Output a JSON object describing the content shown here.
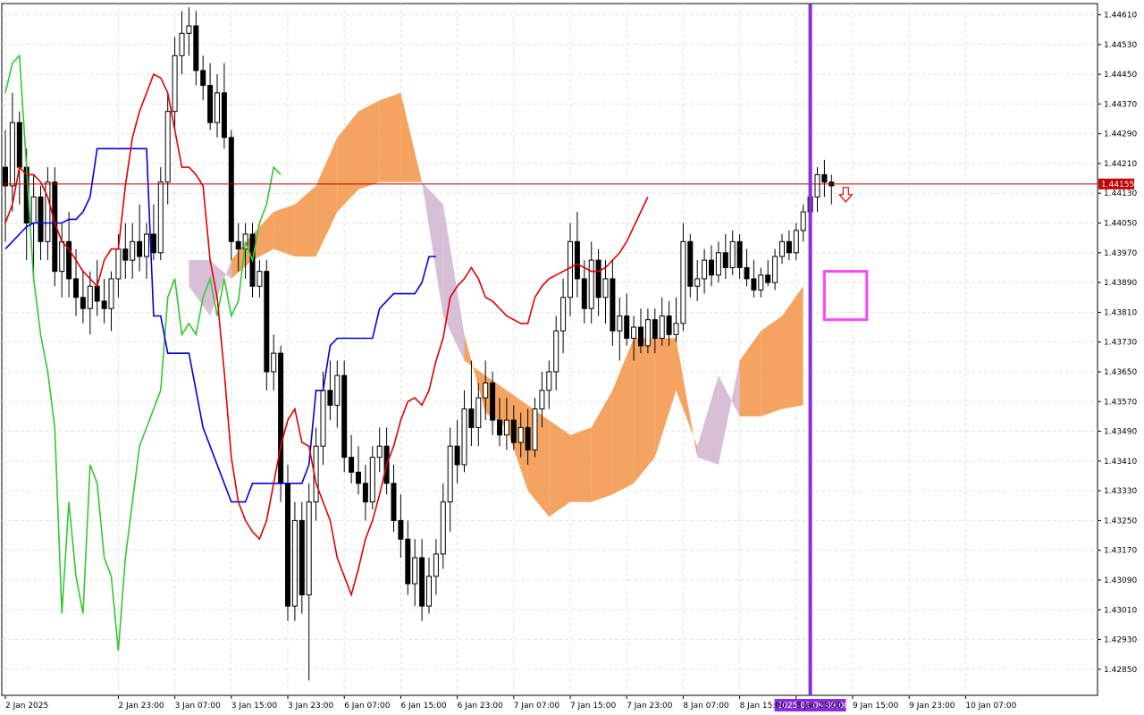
{
  "chart_data": {
    "type": "candlestick",
    "ylim": [
      1.4278,
      1.4464
    ],
    "y_ticks": [
      "1.44610",
      "1.44530",
      "1.44450",
      "1.44370",
      "1.44290",
      "1.44210",
      "1.44130",
      "1.44050",
      "1.43970",
      "1.43890",
      "1.43810",
      "1.43730",
      "1.43650",
      "1.43570",
      "1.43490",
      "1.43410",
      "1.43330",
      "1.43250",
      "1.43170",
      "1.43090",
      "1.43010",
      "1.42930",
      "1.42850"
    ],
    "x_ticks": [
      {
        "label": "2 Jan 2025",
        "index": 0
      },
      {
        "label": "2 Jan 23:00",
        "index": 16
      },
      {
        "label": "3 Jan 07:00",
        "index": 24
      },
      {
        "label": "3 Jan 15:00",
        "index": 32
      },
      {
        "label": "3 Jan 23:00",
        "index": 40
      },
      {
        "label": "6 Jan 07:00",
        "index": 48
      },
      {
        "label": "6 Jan 15:00",
        "index": 56
      },
      {
        "label": "6 Jan 23:00",
        "index": 64
      },
      {
        "label": "7 Jan 07:00",
        "index": 72
      },
      {
        "label": "7 Jan 15:00",
        "index": 80
      },
      {
        "label": "7 Jan 23:00",
        "index": 88
      },
      {
        "label": "8 Jan 07:00",
        "index": 96
      },
      {
        "label": "8 Jan 15:00",
        "index": 104
      },
      {
        "label": "8 Jan 23:00",
        "index": 112
      },
      {
        "label": "9 Jan 15:00",
        "index": 120
      },
      {
        "label": "9 Jan 23:00",
        "index": 128
      },
      {
        "label": "10 Jan 07:00",
        "index": 136
      }
    ],
    "current_price": "1.44155",
    "current_price_value": 1.44155,
    "vline_label": "2025.01.09 09:00",
    "vline_index": 114,
    "series_ohlc": [
      [
        1.442,
        1.443,
        1.44,
        1.4415
      ],
      [
        1.4415,
        1.444,
        1.4408,
        1.4432
      ],
      [
        1.4432,
        1.4435,
        1.441,
        1.442
      ],
      [
        1.442,
        1.4425,
        1.4395,
        1.4405
      ],
      [
        1.4405,
        1.4418,
        1.439,
        1.4412
      ],
      [
        1.4412,
        1.4415,
        1.4395,
        1.44
      ],
      [
        1.44,
        1.442,
        1.4395,
        1.4416
      ],
      [
        1.4416,
        1.442,
        1.4388,
        1.4392
      ],
      [
        1.4392,
        1.4405,
        1.4385,
        1.44
      ],
      [
        1.44,
        1.4408,
        1.4385,
        1.439
      ],
      [
        1.439,
        1.4398,
        1.438,
        1.4385
      ],
      [
        1.4385,
        1.4392,
        1.4378,
        1.4382
      ],
      [
        1.4382,
        1.4392,
        1.4375,
        1.4388
      ],
      [
        1.4388,
        1.4395,
        1.438,
        1.4384
      ],
      [
        1.4384,
        1.439,
        1.4378,
        1.4382
      ],
      [
        1.4382,
        1.4392,
        1.4376,
        1.439
      ],
      [
        1.439,
        1.4402,
        1.4385,
        1.4398
      ],
      [
        1.4398,
        1.4405,
        1.439,
        1.4395
      ],
      [
        1.4395,
        1.4405,
        1.439,
        1.44
      ],
      [
        1.44,
        1.441,
        1.4392,
        1.4396
      ],
      [
        1.4396,
        1.4405,
        1.439,
        1.4402
      ],
      [
        1.4402,
        1.441,
        1.4395,
        1.4397
      ],
      [
        1.4397,
        1.442,
        1.4395,
        1.4416
      ],
      [
        1.4416,
        1.444,
        1.441,
        1.4435
      ],
      [
        1.4435,
        1.4455,
        1.443,
        1.445
      ],
      [
        1.445,
        1.4462,
        1.4445,
        1.4456
      ],
      [
        1.4456,
        1.4463,
        1.445,
        1.4458
      ],
      [
        1.4458,
        1.4462,
        1.4442,
        1.4446
      ],
      [
        1.4446,
        1.445,
        1.4438,
        1.4442
      ],
      [
        1.4442,
        1.4448,
        1.443,
        1.4432
      ],
      [
        1.4432,
        1.4445,
        1.4428,
        1.444
      ],
      [
        1.444,
        1.4448,
        1.4425,
        1.4428
      ],
      [
        1.4428,
        1.443,
        1.4395,
        1.44
      ],
      [
        1.44,
        1.4405,
        1.4392,
        1.4398
      ],
      [
        1.4398,
        1.4405,
        1.439,
        1.4402
      ],
      [
        1.4402,
        1.4405,
        1.4385,
        1.4388
      ],
      [
        1.4388,
        1.4395,
        1.4385,
        1.4392
      ],
      [
        1.4392,
        1.4395,
        1.436,
        1.4365
      ],
      [
        1.4365,
        1.4375,
        1.436,
        1.437
      ],
      [
        1.437,
        1.4372,
        1.433,
        1.4335
      ],
      [
        1.4335,
        1.434,
        1.4298,
        1.4302
      ],
      [
        1.4302,
        1.433,
        1.4298,
        1.4325
      ],
      [
        1.4325,
        1.433,
        1.43,
        1.4305
      ],
      [
        1.4305,
        1.4335,
        1.4282,
        1.433
      ],
      [
        1.433,
        1.435,
        1.4325,
        1.4345
      ],
      [
        1.4345,
        1.4365,
        1.434,
        1.436
      ],
      [
        1.436,
        1.4368,
        1.4352,
        1.4356
      ],
      [
        1.4356,
        1.4368,
        1.435,
        1.4364
      ],
      [
        1.4364,
        1.4368,
        1.4338,
        1.4342
      ],
      [
        1.4342,
        1.4348,
        1.4335,
        1.4338
      ],
      [
        1.4338,
        1.4345,
        1.4332,
        1.4335
      ],
      [
        1.4335,
        1.434,
        1.4325,
        1.433
      ],
      [
        1.433,
        1.4345,
        1.4328,
        1.4342
      ],
      [
        1.4342,
        1.435,
        1.4338,
        1.4345
      ],
      [
        1.4345,
        1.435,
        1.4332,
        1.4335
      ],
      [
        1.4335,
        1.434,
        1.4322,
        1.4325
      ],
      [
        1.4325,
        1.4332,
        1.4315,
        1.432
      ],
      [
        1.432,
        1.4325,
        1.4305,
        1.4308
      ],
      [
        1.4308,
        1.432,
        1.4302,
        1.4315
      ],
      [
        1.4315,
        1.432,
        1.4298,
        1.4302
      ],
      [
        1.4302,
        1.4315,
        1.43,
        1.431
      ],
      [
        1.431,
        1.432,
        1.4305,
        1.4316
      ],
      [
        1.4316,
        1.4335,
        1.4312,
        1.433
      ],
      [
        1.433,
        1.435,
        1.4322,
        1.4345
      ],
      [
        1.4345,
        1.4352,
        1.4335,
        1.434
      ],
      [
        1.434,
        1.436,
        1.4338,
        1.4355
      ],
      [
        1.4355,
        1.4368,
        1.4345,
        1.435
      ],
      [
        1.435,
        1.4362,
        1.4345,
        1.4358
      ],
      [
        1.4358,
        1.4368,
        1.4352,
        1.4362
      ],
      [
        1.4362,
        1.4365,
        1.4348,
        1.4352
      ],
      [
        1.4352,
        1.4358,
        1.4345,
        1.4348
      ],
      [
        1.4348,
        1.4358,
        1.4344,
        1.4352
      ],
      [
        1.4352,
        1.4356,
        1.4344,
        1.4346
      ],
      [
        1.4346,
        1.4354,
        1.4342,
        1.435
      ],
      [
        1.435,
        1.4355,
        1.434,
        1.4344
      ],
      [
        1.4344,
        1.4358,
        1.4342,
        1.4355
      ],
      [
        1.4355,
        1.4365,
        1.435,
        1.436
      ],
      [
        1.436,
        1.4368,
        1.4355,
        1.4365
      ],
      [
        1.4365,
        1.438,
        1.436,
        1.4376
      ],
      [
        1.4376,
        1.439,
        1.437,
        1.4385
      ],
      [
        1.4385,
        1.4405,
        1.438,
        1.44
      ],
      [
        1.44,
        1.4408,
        1.4385,
        1.439
      ],
      [
        1.439,
        1.4395,
        1.4378,
        1.4382
      ],
      [
        1.4382,
        1.44,
        1.4378,
        1.4395
      ],
      [
        1.4395,
        1.4398,
        1.438,
        1.4385
      ],
      [
        1.4385,
        1.4395,
        1.4378,
        1.439
      ],
      [
        1.439,
        1.4395,
        1.4372,
        1.4376
      ],
      [
        1.4376,
        1.4385,
        1.4368,
        1.438
      ],
      [
        1.438,
        1.4386,
        1.4372,
        1.4374
      ],
      [
        1.4374,
        1.438,
        1.4368,
        1.4377
      ],
      [
        1.4377,
        1.4382,
        1.437,
        1.4372
      ],
      [
        1.4372,
        1.4382,
        1.437,
        1.4379
      ],
      [
        1.4379,
        1.4382,
        1.437,
        1.4374
      ],
      [
        1.4374,
        1.4385,
        1.4372,
        1.438
      ],
      [
        1.438,
        1.4384,
        1.4372,
        1.4375
      ],
      [
        1.4375,
        1.4385,
        1.4373,
        1.4378
      ],
      [
        1.4378,
        1.4405,
        1.4376,
        1.44
      ],
      [
        1.44,
        1.4402,
        1.4385,
        1.4388
      ],
      [
        1.4388,
        1.4395,
        1.4384,
        1.439
      ],
      [
        1.439,
        1.4398,
        1.4386,
        1.4395
      ],
      [
        1.4395,
        1.4399,
        1.4388,
        1.4391
      ],
      [
        1.4391,
        1.44,
        1.4389,
        1.4397
      ],
      [
        1.4397,
        1.4402,
        1.439,
        1.4393
      ],
      [
        1.4393,
        1.4403,
        1.4391,
        1.44
      ],
      [
        1.44,
        1.4402,
        1.439,
        1.4393
      ],
      [
        1.4393,
        1.4398,
        1.4388,
        1.439
      ],
      [
        1.439,
        1.4395,
        1.4385,
        1.4387
      ],
      [
        1.4387,
        1.4393,
        1.4385,
        1.4391
      ],
      [
        1.4391,
        1.4395,
        1.4388,
        1.4389
      ],
      [
        1.4389,
        1.4398,
        1.4387,
        1.4396
      ],
      [
        1.4396,
        1.4402,
        1.4394,
        1.44
      ],
      [
        1.44,
        1.4403,
        1.4395,
        1.4397
      ],
      [
        1.4397,
        1.4405,
        1.4395,
        1.4403
      ],
      [
        1.4403,
        1.441,
        1.44,
        1.4408
      ],
      [
        1.4408,
        1.4415,
        1.4405,
        1.4412
      ],
      [
        1.4412,
        1.442,
        1.4408,
        1.4418
      ],
      [
        1.4418,
        1.4422,
        1.4412,
        1.4416
      ],
      [
        1.4416,
        1.4418,
        1.441,
        1.4415
      ]
    ],
    "tenkan": [
      1.4405,
      1.441,
      1.442,
      1.4418,
      1.4418,
      1.4416,
      1.4412,
      1.4405,
      1.44,
      1.4398,
      1.4395,
      1.4392,
      1.439,
      1.4388,
      1.4395,
      1.4398,
      1.4398,
      1.4415,
      1.4428,
      1.4435,
      1.444,
      1.4445,
      1.4444,
      1.444,
      1.443,
      1.442,
      1.442,
      1.4418,
      1.4415,
      1.4395,
      1.4385,
      1.4365,
      1.4342,
      1.433,
      1.4325,
      1.4322,
      1.432,
      1.4325,
      1.4335,
      1.4345,
      1.4352,
      1.4355,
      1.4346,
      1.4345,
      1.4335,
      1.433,
      1.4325,
      1.4315,
      1.431,
      1.4305,
      1.4312,
      1.432,
      1.4325,
      1.4332,
      1.434,
      1.4345,
      1.4352,
      1.4357,
      1.4358,
      1.4356,
      1.436,
      1.4368,
      1.4374,
      1.4385,
      1.4388,
      1.439,
      1.4393,
      1.439,
      1.4385,
      1.4384,
      1.4382,
      1.438,
      1.4379,
      1.4378,
      1.4378,
      1.4385,
      1.4388,
      1.439,
      1.4391,
      1.4392,
      1.4393,
      1.4394,
      1.4393,
      1.4392,
      1.4392,
      1.4393,
      1.4395,
      1.4397,
      1.44,
      1.4404,
      1.4408,
      1.4412
    ],
    "kijun": [
      1.4398,
      1.44,
      1.4402,
      1.4404,
      1.4405,
      1.4405,
      1.4405,
      1.4405,
      1.4405,
      1.4406,
      1.4406,
      1.4408,
      1.4412,
      1.4425,
      1.4425,
      1.4425,
      1.4425,
      1.4425,
      1.4425,
      1.4425,
      1.4425,
      1.438,
      1.438,
      1.437,
      1.437,
      1.437,
      1.437,
      1.436,
      1.435,
      1.4345,
      1.434,
      1.4335,
      1.433,
      1.433,
      1.433,
      1.4335,
      1.4335,
      1.4335,
      1.4335,
      1.4335,
      1.4335,
      1.4335,
      1.4335,
      1.434,
      1.436,
      1.436,
      1.4372,
      1.4374,
      1.4374,
      1.4374,
      1.4374,
      1.4374,
      1.4374,
      1.4382,
      1.4384,
      1.4386,
      1.4386,
      1.4386,
      1.4386,
      1.4389,
      1.4396,
      1.4396
    ],
    "chikou": [
      1.444,
      1.4448,
      1.445,
      1.442,
      1.439,
      1.4375,
      1.4365,
      1.435,
      1.43,
      1.433,
      1.431,
      1.43,
      1.434,
      1.4335,
      1.4315,
      1.431,
      1.429,
      1.4315,
      1.433,
      1.4345,
      1.435,
      1.4355,
      1.436,
      1.4385,
      1.439,
      1.4375,
      1.4378,
      1.4375,
      1.4385,
      1.439,
      1.438,
      1.439,
      1.438,
      1.4384,
      1.44,
      1.4395,
      1.4405,
      1.441,
      1.442,
      1.4418
    ],
    "kumo": [
      {
        "a": 1.4388,
        "b": 1.4395
      },
      {
        "a": 1.438,
        "b": 1.4395
      },
      {
        "a": 1.4395,
        "b": 1.439
      },
      {
        "a": 1.4402,
        "b": 1.4395
      },
      {
        "a": 1.4408,
        "b": 1.4398
      },
      {
        "a": 1.441,
        "b": 1.4396
      },
      {
        "a": 1.4415,
        "b": 1.4396
      },
      {
        "a": 1.4428,
        "b": 1.4408
      },
      {
        "a": 1.4435,
        "b": 1.4414
      },
      {
        "a": 1.4438,
        "b": 1.4416
      },
      {
        "a": 1.444,
        "b": 1.4416
      },
      {
        "a": 1.4416,
        "b": 1.4416
      },
      {
        "a": 1.438,
        "b": 1.441
      },
      {
        "a": 1.4368,
        "b": 1.4375
      },
      {
        "a": 1.4364,
        "b": 1.4354
      },
      {
        "a": 1.436,
        "b": 1.435
      },
      {
        "a": 1.4356,
        "b": 1.4333
      },
      {
        "a": 1.4352,
        "b": 1.4326
      },
      {
        "a": 1.4348,
        "b": 1.433
      },
      {
        "a": 1.435,
        "b": 1.433
      },
      {
        "a": 1.436,
        "b": 1.4332
      },
      {
        "a": 1.4374,
        "b": 1.4335
      },
      {
        "a": 1.4374,
        "b": 1.4342
      },
      {
        "a": 1.4374,
        "b": 1.436
      },
      {
        "a": 1.4342,
        "b": 1.4345
      },
      {
        "a": 1.434,
        "b": 1.4364
      },
      {
        "a": 1.4368,
        "b": 1.4353
      },
      {
        "a": 1.4376,
        "b": 1.4353
      },
      {
        "a": 1.438,
        "b": 1.4355
      },
      {
        "a": 1.4388,
        "b": 1.4356
      }
    ]
  }
}
